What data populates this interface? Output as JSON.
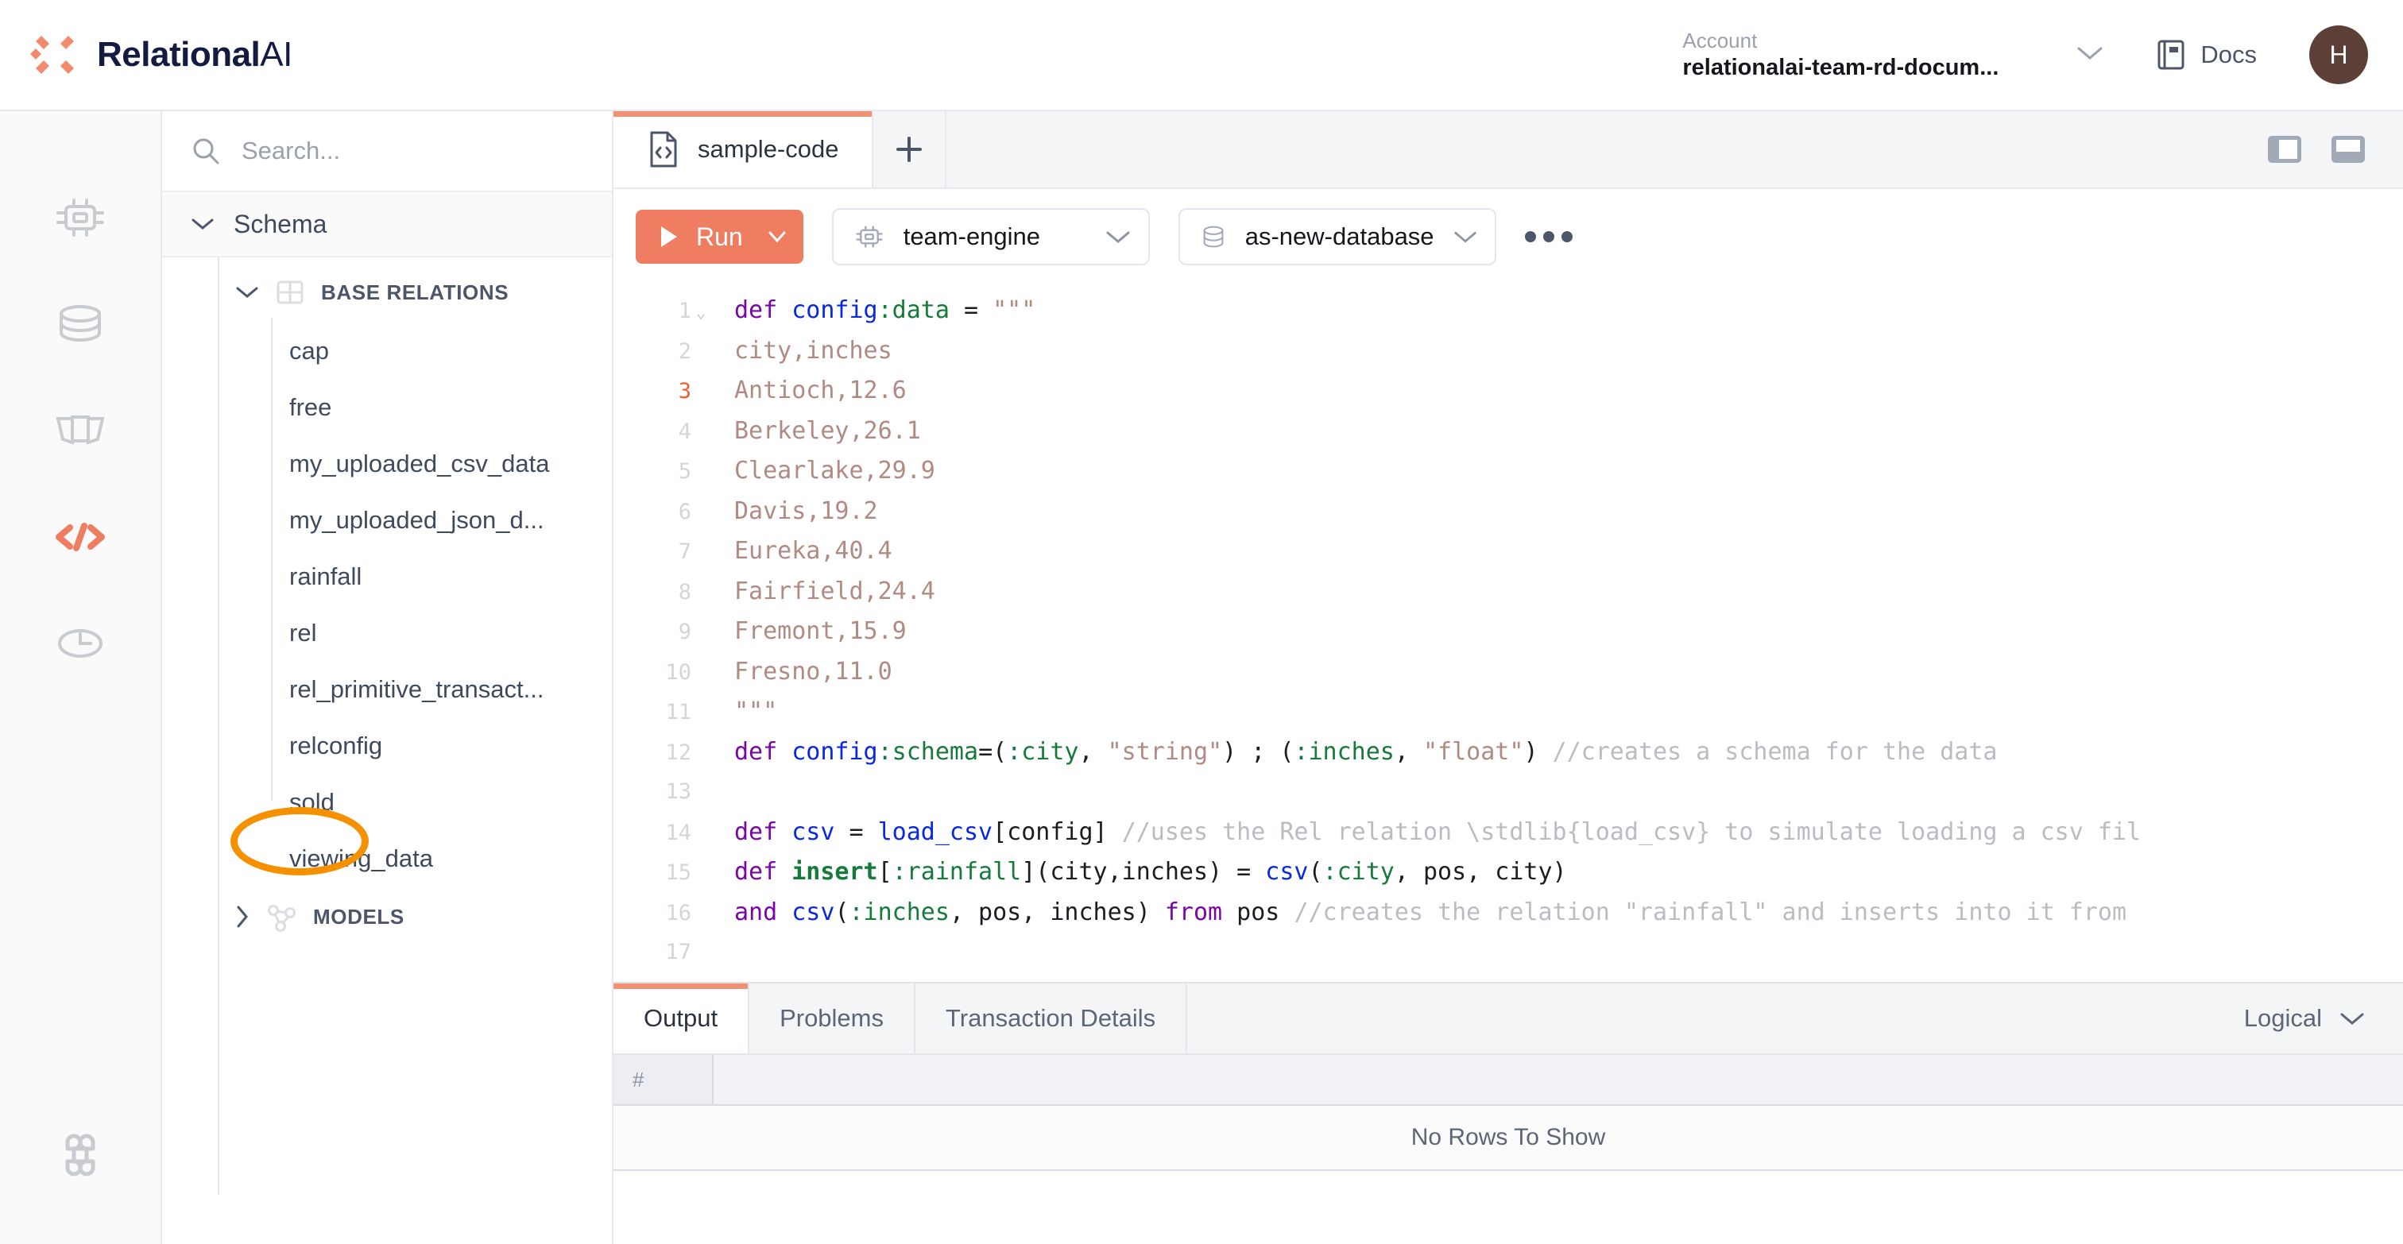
{
  "brand": {
    "name": "Relational",
    "suffix": "AI",
    "mark_color": "#f28b6e",
    "text_color": "#141b40"
  },
  "topbar": {
    "account_label": "Account",
    "account_value": "relationalai-team-rd-docum...",
    "docs_label": "Docs",
    "avatar_initial": "H",
    "avatar_color": "#5c4037"
  },
  "rail": {
    "items": [
      {
        "name": "engine",
        "icon": "chip-icon",
        "active": false
      },
      {
        "name": "database",
        "icon": "database-icon",
        "active": false
      },
      {
        "name": "model",
        "icon": "book-icon",
        "active": false
      },
      {
        "name": "editor",
        "icon": "code-icon",
        "active": true
      },
      {
        "name": "history",
        "icon": "clock-icon",
        "active": false
      }
    ],
    "bottom": {
      "name": "shortcuts",
      "icon": "command-icon"
    },
    "active_color": "#ee7d62",
    "inactive_color": "#c8cbd0"
  },
  "sidebar": {
    "search_placeholder": "Search...",
    "schema_label": "Schema",
    "groups": [
      {
        "label": "BASE RELATIONS",
        "icon": "table-icon",
        "expanded": true,
        "items": [
          "cap",
          "free",
          "my_uploaded_csv_data",
          "my_uploaded_json_d...",
          "rainfall",
          "rel",
          "rel_primitive_transact...",
          "relconfig",
          "sold",
          "viewing_data"
        ]
      },
      {
        "label": "MODELS",
        "icon": "graph-icon",
        "expanded": false,
        "items": []
      }
    ],
    "annotation": {
      "target": "rainfall",
      "shape": "ellipse",
      "color": "#f59000"
    }
  },
  "tabs": {
    "items": [
      {
        "label": "sample-code",
        "icon": "file-code-icon",
        "active": true
      }
    ],
    "new_tab_icon": "plus-icon",
    "panel_toggles": [
      {
        "name": "toggle-side-panel",
        "icon": "side-panel-icon"
      },
      {
        "name": "toggle-bottom-panel",
        "icon": "bottom-panel-icon"
      }
    ]
  },
  "toolbar": {
    "run_label": "Run",
    "run_color": "#ee7d62",
    "run_icon": "play-icon",
    "run_chevron": "chevron-down-icon",
    "engine_value": "team-engine",
    "engine_icon": "chip-icon",
    "database_value": "as-new-database",
    "database_icon": "database-icon",
    "more_icon": "ellipsis-icon"
  },
  "editor": {
    "cursor_line": 3,
    "lines": [
      {
        "n": 1,
        "fold": true,
        "tokens": [
          {
            "t": "def ",
            "c": "kw"
          },
          {
            "t": "config",
            "c": "fn"
          },
          {
            "t": ":data",
            "c": "sym"
          },
          {
            "t": " = ",
            "c": "pl"
          },
          {
            "t": "\"\"\"",
            "c": "str"
          }
        ]
      },
      {
        "n": 2,
        "tokens": [
          {
            "t": "city,inches",
            "c": "str"
          }
        ]
      },
      {
        "n": 3,
        "tokens": [
          {
            "t": "Antioch,12.6",
            "c": "str"
          }
        ]
      },
      {
        "n": 4,
        "tokens": [
          {
            "t": "Berkeley,26.1",
            "c": "str"
          }
        ]
      },
      {
        "n": 5,
        "tokens": [
          {
            "t": "Clearlake,29.9",
            "c": "str"
          }
        ]
      },
      {
        "n": 6,
        "tokens": [
          {
            "t": "Davis,19.2",
            "c": "str"
          }
        ]
      },
      {
        "n": 7,
        "tokens": [
          {
            "t": "Eureka,40.4",
            "c": "str"
          }
        ]
      },
      {
        "n": 8,
        "tokens": [
          {
            "t": "Fairfield,24.4",
            "c": "str"
          }
        ]
      },
      {
        "n": 9,
        "tokens": [
          {
            "t": "Fremont,15.9",
            "c": "str"
          }
        ]
      },
      {
        "n": 10,
        "tokens": [
          {
            "t": "Fresno,11.0",
            "c": "str"
          }
        ]
      },
      {
        "n": 11,
        "tokens": [
          {
            "t": "\"\"\"",
            "c": "str"
          }
        ]
      },
      {
        "n": 12,
        "tokens": [
          {
            "t": "def ",
            "c": "kw"
          },
          {
            "t": "config",
            "c": "fn"
          },
          {
            "t": ":schema",
            "c": "sym"
          },
          {
            "t": "=(",
            "c": "pl"
          },
          {
            "t": ":city",
            "c": "sym"
          },
          {
            "t": ", ",
            "c": "pl"
          },
          {
            "t": "\"string\"",
            "c": "str"
          },
          {
            "t": ") ; (",
            "c": "pl"
          },
          {
            "t": ":inches",
            "c": "sym"
          },
          {
            "t": ", ",
            "c": "pl"
          },
          {
            "t": "\"float\"",
            "c": "str"
          },
          {
            "t": ") ",
            "c": "pl"
          },
          {
            "t": "//creates a schema for the data",
            "c": "com"
          }
        ]
      },
      {
        "n": 13,
        "tokens": []
      },
      {
        "n": 14,
        "tokens": [
          {
            "t": "def ",
            "c": "kw"
          },
          {
            "t": "csv",
            "c": "fn"
          },
          {
            "t": " = ",
            "c": "pl"
          },
          {
            "t": "load_csv",
            "c": "fn"
          },
          {
            "t": "[config] ",
            "c": "pl"
          },
          {
            "t": "//uses the Rel relation \\stdlib{load_csv} to simulate loading a csv fil",
            "c": "com"
          }
        ]
      },
      {
        "n": 15,
        "tokens": [
          {
            "t": "def ",
            "c": "kw"
          },
          {
            "t": "insert",
            "c": "symb"
          },
          {
            "t": "[",
            "c": "pl"
          },
          {
            "t": ":rainfall",
            "c": "sym"
          },
          {
            "t": "](city,inches) = ",
            "c": "pl"
          },
          {
            "t": "csv",
            "c": "fn"
          },
          {
            "t": "(",
            "c": "pl"
          },
          {
            "t": ":city",
            "c": "sym"
          },
          {
            "t": ", pos, city)",
            "c": "pl"
          }
        ]
      },
      {
        "n": 16,
        "tokens": [
          {
            "t": "and ",
            "c": "kw"
          },
          {
            "t": "csv",
            "c": "fn"
          },
          {
            "t": "(",
            "c": "pl"
          },
          {
            "t": ":inches",
            "c": "sym"
          },
          {
            "t": ", pos, inches) ",
            "c": "pl"
          },
          {
            "t": "from",
            "c": "kw"
          },
          {
            "t": " pos ",
            "c": "pl"
          },
          {
            "t": "//creates the relation \"rainfall\" and inserts into it from",
            "c": "com"
          }
        ]
      },
      {
        "n": 17,
        "tokens": []
      }
    ]
  },
  "output": {
    "tabs": [
      {
        "label": "Output",
        "active": true
      },
      {
        "label": "Problems",
        "active": false
      },
      {
        "label": "Transaction Details",
        "active": false
      }
    ],
    "mode_label": "Logical",
    "mode_chevron": "chevron-down-icon",
    "grid": {
      "columns": [
        "#"
      ],
      "rows": [],
      "empty_message": "No Rows To Show"
    }
  }
}
